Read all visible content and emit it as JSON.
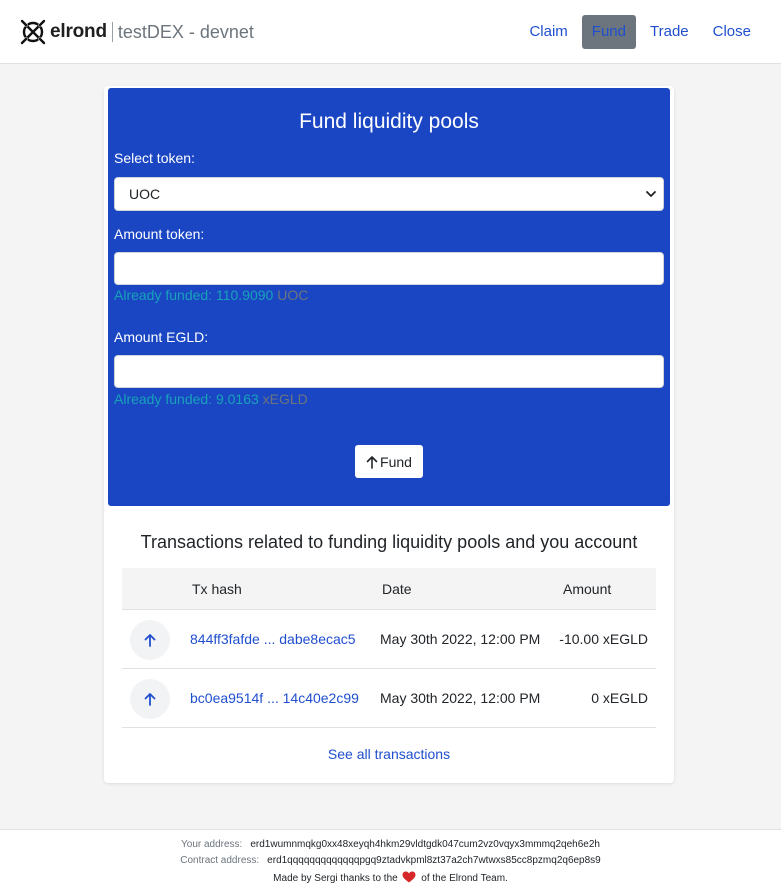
{
  "app": {
    "brand": "elrond",
    "app_name": "testDEX - devnet"
  },
  "nav": {
    "items": [
      {
        "label": "Claim"
      },
      {
        "label": "Fund",
        "active": true
      },
      {
        "label": "Trade"
      },
      {
        "label": "Close"
      }
    ]
  },
  "form": {
    "title": "Fund liquidity pools",
    "select_token_label": "Select token:",
    "selected_token": "UOC",
    "amount_token_label": "Amount token:",
    "amount_token_value": "",
    "token_funded_text": "Already funded: 110.9090",
    "token_funded_unit": "UOC",
    "amount_egld_label": "Amount EGLD:",
    "amount_egld_value": "",
    "egld_funded_text": "Already funded: 9.0163",
    "egld_funded_unit": "xEGLD",
    "fund_button": "Fund"
  },
  "transactions": {
    "title": "Transactions related to funding liquidity pools and you account",
    "columns": [
      "Tx hash",
      "Date",
      "Amount"
    ],
    "rows": [
      {
        "hash": "844ff3fafde ... dabe8ecac5",
        "date": "May 30th 2022, 12:00 PM",
        "amount": "-10.00 xEGLD"
      },
      {
        "hash": "bc0ea9514f ... 14c40e2c99",
        "date": "May 30th 2022, 12:00 PM",
        "amount": "0 xEGLD"
      }
    ],
    "see_all": "See all transactions"
  },
  "footer": {
    "your_address_label": "Your address:",
    "your_address": "erd1wumnmqkg0xx48xeyqh4hkm29vldtgdk047cum2vz0vqyx3mmmq2qeh6e2h",
    "contract_address_label": "Contract address:",
    "contract_address": "erd1qqqqqqqqqqqqqpgq9ztadvkpml8zt37a2ch7wtwxs85cc8pzmq2q6ep8s9",
    "made_by_prefix": "Made by Sergi thanks to the",
    "made_by_suffix": "of the Elrond Team."
  },
  "colors": {
    "panel_blue": "#1a46c4",
    "link_blue": "#1f4fcf",
    "funded_teal": "#17a2b8",
    "heart_red": "#d62828"
  },
  "icons": [
    "elrond-logo-icon",
    "arrow-up-icon",
    "select-caret-icon",
    "heart-icon"
  ]
}
